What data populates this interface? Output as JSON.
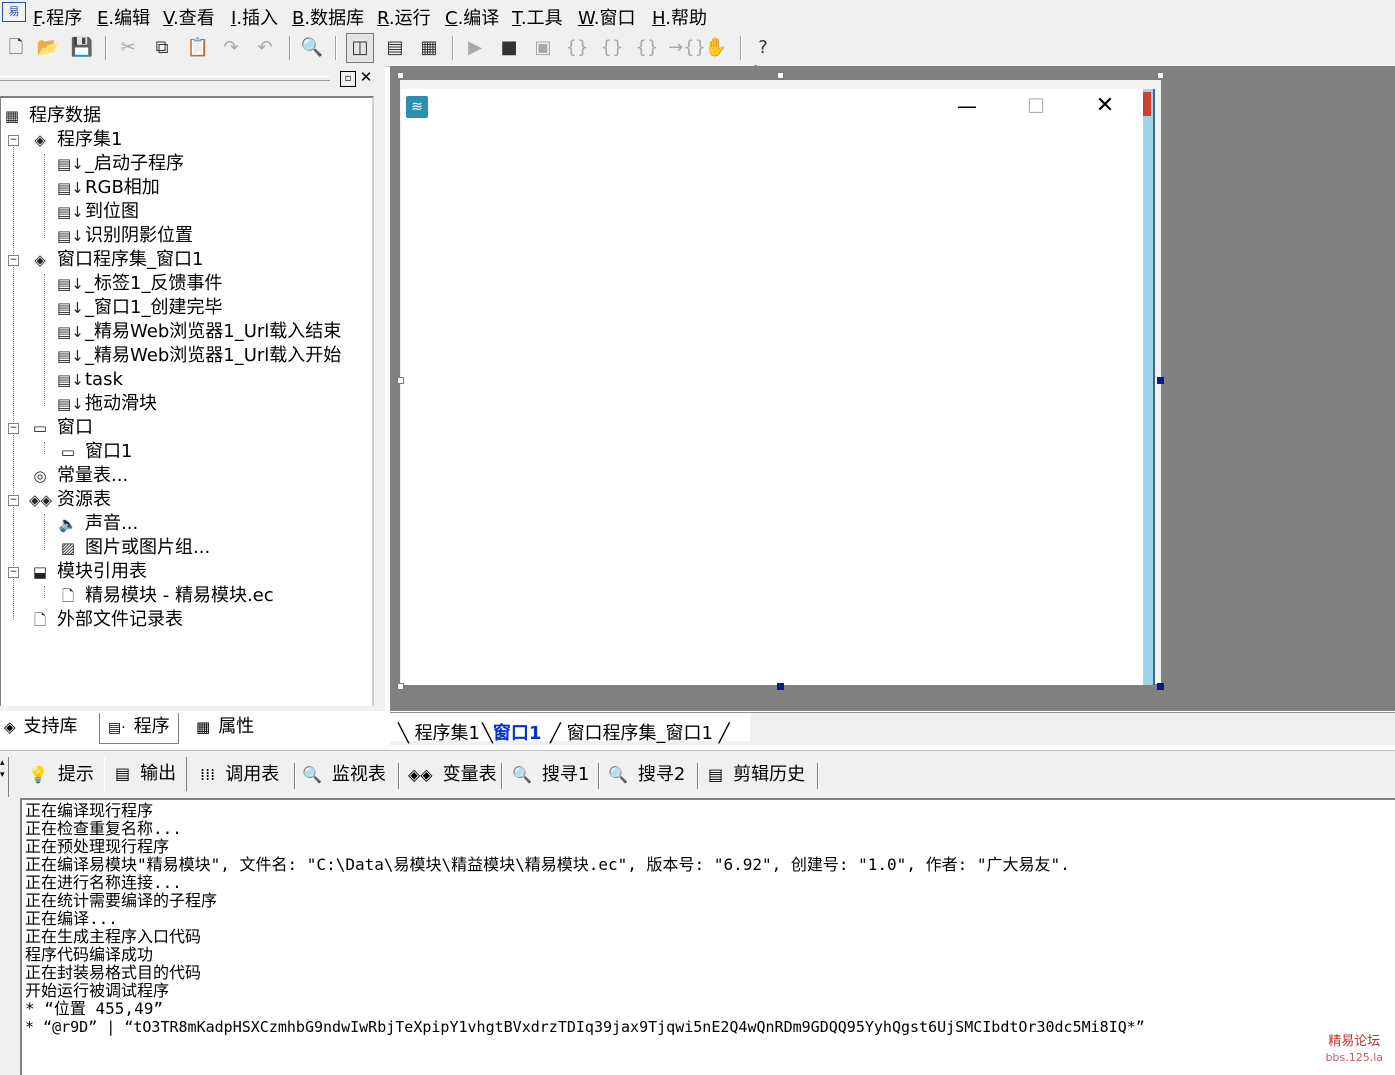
{
  "menu": {
    "items": [
      {
        "key": "F",
        "label": ".程序"
      },
      {
        "key": "E",
        "label": ".编辑"
      },
      {
        "key": "V",
        "label": ".查看"
      },
      {
        "key": "I",
        "label": ".插入"
      },
      {
        "key": "B",
        "label": ".数据库"
      },
      {
        "key": "R",
        "label": ".运行"
      },
      {
        "key": "C",
        "label": ".编译"
      },
      {
        "key": "T",
        "label": ".工具"
      },
      {
        "key": "W",
        "label": ".窗口"
      },
      {
        "key": "H",
        "label": ".帮助"
      }
    ]
  },
  "toolbar": {
    "icons": [
      "new-icon",
      "open-icon",
      "save-icon",
      "cut-icon",
      "copy-icon",
      "paste-icon",
      "redo-icon",
      "undo-icon",
      "find-icon",
      "layout-1-icon",
      "layout-2-icon",
      "layout-3-icon",
      "run-icon",
      "stop-icon",
      "step-icon",
      "step-into-icon",
      "step-over-icon",
      "step-out-icon",
      "run-to-icon",
      "hand-icon",
      "help-search-icon"
    ]
  },
  "tree": {
    "root": "程序数据",
    "set1": "程序集1",
    "set1_items": [
      "_启动子程序",
      "RGB相加",
      "到位图",
      "识别阴影位置"
    ],
    "set2": "窗口程序集_窗口1",
    "set2_items": [
      "_标签1_反馈事件",
      "_窗口1_创建完毕",
      "_精易Web浏览器1_Url载入结束",
      "_精易Web浏览器1_Url载入开始",
      "task",
      "拖动滑块"
    ],
    "window": "窗口",
    "window_items": [
      "窗口1"
    ],
    "constants": "常量表...",
    "resources": "资源表",
    "resource_items": [
      "声音...",
      "图片或图片组..."
    ],
    "modules": "模块引用表",
    "module_items": [
      "精易模块 - 精易模块.ec"
    ],
    "external": "外部文件记录表"
  },
  "left_tabs": [
    "支持库",
    "程序",
    "属性"
  ],
  "design_tabs": [
    "程序集1",
    "窗口1",
    "窗口程序集_窗口1"
  ],
  "bottom_tabs": [
    "提示",
    "输出",
    "调用表",
    "监视表",
    "变量表",
    "搜寻1",
    "搜寻2",
    "剪辑历史"
  ],
  "output_lines": [
    "正在编译现行程序",
    "正在检查重复名称...",
    "正在预处理现行程序",
    "正在编译易模块\"精易模块\", 文件名: \"C:\\Data\\易模块\\精益模块\\精易模块.ec\", 版本号: \"6.92\", 创建号: \"1.0\", 作者: \"广大易友\".",
    "正在进行名称连接...",
    "正在统计需要编译的子程序",
    "正在编译...",
    "正在生成主程序入口代码",
    "程序代码编译成功",
    "正在封装易格式目的代码",
    "开始运行被调试程序",
    "* “位置 455,49”",
    "* “@r9D” | “tO3TR8mKadpHSXCzmhbG9ndwIwRbjTeXpipY1vhgtBVxdrzTDIq39jax9Tjqwi5nE2Q4wQnRDm9GDQQ95YyhQgst6UjSMCIbdtOr30dc5Mi8IQ*”"
  ],
  "watermark": {
    "line1": "精易论坛",
    "line2": "bbs.125.la"
  },
  "colors": {
    "selected_tab": "#0033cc",
    "handle_black": "#0a1a8a",
    "design_bg": "#808080"
  }
}
